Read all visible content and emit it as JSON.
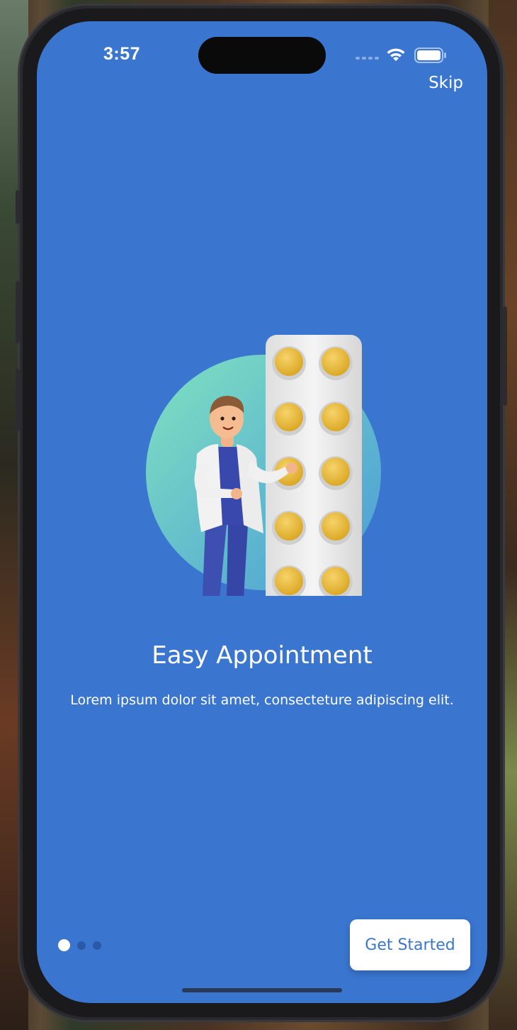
{
  "status_bar": {
    "time": "3:57"
  },
  "header": {
    "skip_label": "Skip"
  },
  "onboarding": {
    "title": "Easy Appointment",
    "description": "Lorem ipsum dolor sit amet, consecteture adipiscing elit.",
    "page_index": 1,
    "page_count": 3
  },
  "footer": {
    "cta_label": "Get Started"
  },
  "colors": {
    "screen_background": "#3a76d0",
    "button_background": "#ffffff",
    "button_text": "#3a76d0",
    "pager_active": "#ffffff",
    "pager_inactive": "#2a5aa6"
  },
  "icons": [
    "wifi-icon",
    "battery-icon",
    "cellular-signal-icon"
  ]
}
